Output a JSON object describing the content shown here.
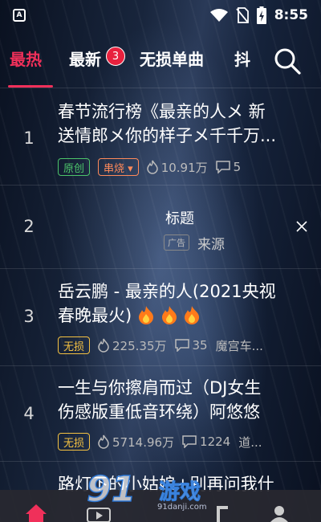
{
  "status_bar": {
    "app_badge": "A",
    "time": "8:55",
    "icons": [
      "wifi-icon",
      "no-sim-icon",
      "battery-charging-icon"
    ]
  },
  "tabs": [
    {
      "label": "最热",
      "active": true
    },
    {
      "label": "最新",
      "badge": "3"
    },
    {
      "label": "无损单曲"
    },
    {
      "label": "抖"
    }
  ],
  "list": [
    {
      "rank": "1",
      "title_line1": "春节流行榜《最亲的人メ 新",
      "title_line2": "送情郎メ你的样子メ千千万...",
      "tags": [
        "原创",
        "串烧 ▾"
      ],
      "plays": "10.91万",
      "comments": "5"
    },
    {
      "rank": "2",
      "ad_title": "标题",
      "ad_label": "广告",
      "ad_source": "来源"
    },
    {
      "rank": "3",
      "title_line1": "岳云鹏 - 最亲的人(2021央视",
      "title_line2": "春晚最火)",
      "tags": [
        "无损"
      ],
      "plays": "225.35万",
      "comments": "35",
      "uploader": "魔宫车..."
    },
    {
      "rank": "4",
      "title_line1": "一生与你擦肩而过（DJ女生",
      "title_line2": "伤感版重低音环绕）阿悠悠",
      "tags": [
        "无损"
      ],
      "plays": "5714.96万",
      "comments": "1224",
      "uploader": "道..."
    },
    {
      "rank": "5",
      "title_line1": "路灯下的小姑娘+别再问我什"
    }
  ],
  "watermark": {
    "text": "91",
    "sub": "游戏",
    "domain": "91danji.com"
  },
  "colors": {
    "accent": "#f0305a",
    "badge": "#e8213e",
    "tag_green": "#4cc46a",
    "tag_orange": "#ff8a5a",
    "tag_gold": "#f5c242"
  },
  "bottom_nav": [
    "home-icon",
    "video-icon",
    "music-icon",
    "profile-icon"
  ]
}
